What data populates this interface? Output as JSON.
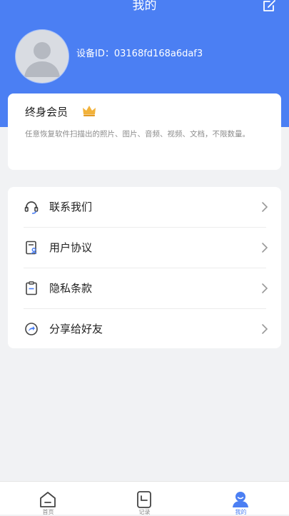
{
  "header": {
    "title": "我的",
    "edit_icon": "edit-icon",
    "device_label": "设备ID：",
    "device_id": "03168fd168a6daf3"
  },
  "colors": {
    "primary": "#4b7ff3",
    "background": "#f1f2f4",
    "card": "#ffffff",
    "crown": "#f2b23a"
  },
  "membership": {
    "title": "终身会员",
    "badge_icon": "crown-icon",
    "description": "任意恢复软件扫描出的照片、图片、音频、视频、文档，不限数量。"
  },
  "menu": {
    "items": [
      {
        "label": "联系我们",
        "icon": "headset-icon"
      },
      {
        "label": "用户协议",
        "icon": "document-user-icon"
      },
      {
        "label": "隐私条款",
        "icon": "clipboard-icon"
      },
      {
        "label": "分享给好友",
        "icon": "share-icon"
      }
    ]
  },
  "tabbar": {
    "tabs": [
      {
        "label": "首页",
        "icon": "home-icon",
        "active": false
      },
      {
        "label": "记录",
        "icon": "record-icon",
        "active": false
      },
      {
        "label": "我的",
        "icon": "profile-icon",
        "active": true
      }
    ]
  }
}
